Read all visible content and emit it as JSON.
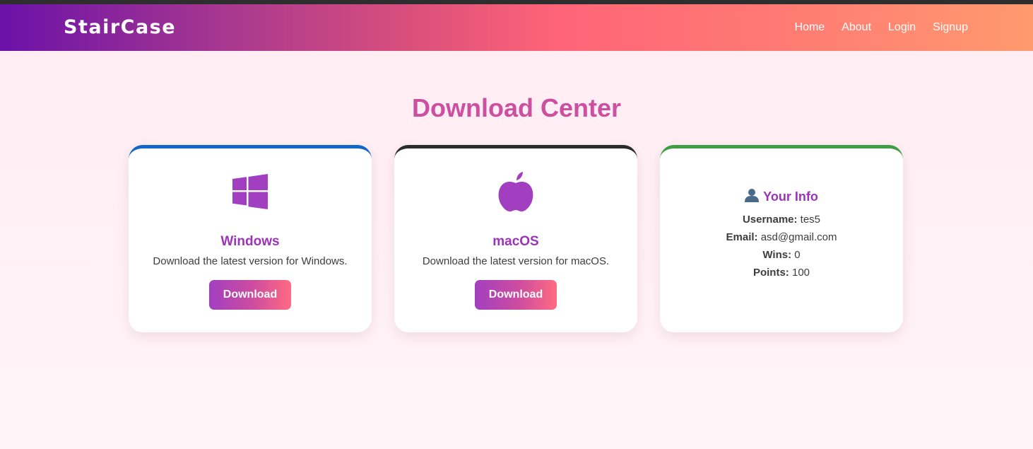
{
  "navbar": {
    "brand": "StairCase",
    "links": [
      "Home",
      "About",
      "Login",
      "Signup"
    ]
  },
  "main": {
    "title": "Download Center"
  },
  "cards": [
    {
      "icon": "windows-logo-icon",
      "title": "Windows",
      "description": "Download the latest version for Windows.",
      "button_label": "Download",
      "accent": "#1467c8"
    },
    {
      "icon": "apple-logo-icon",
      "title": "macOS",
      "description": "Download the latest version for macOS.",
      "button_label": "Download",
      "accent": "#2b2b2b"
    }
  ],
  "user_info": {
    "icon": "user-icon",
    "title": "Your Info",
    "accent": "#3e9e45",
    "fields": [
      {
        "label": "Username:",
        "value": "tes5"
      },
      {
        "label": "Email:",
        "value": "asd@gmail.com"
      },
      {
        "label": "Wins:",
        "value": "0"
      },
      {
        "label": "Points:",
        "value": "100"
      }
    ]
  },
  "colors": {
    "title": "#cc4fa0",
    "card_heading": "#9b34b8",
    "icon": "#a23fc0"
  }
}
